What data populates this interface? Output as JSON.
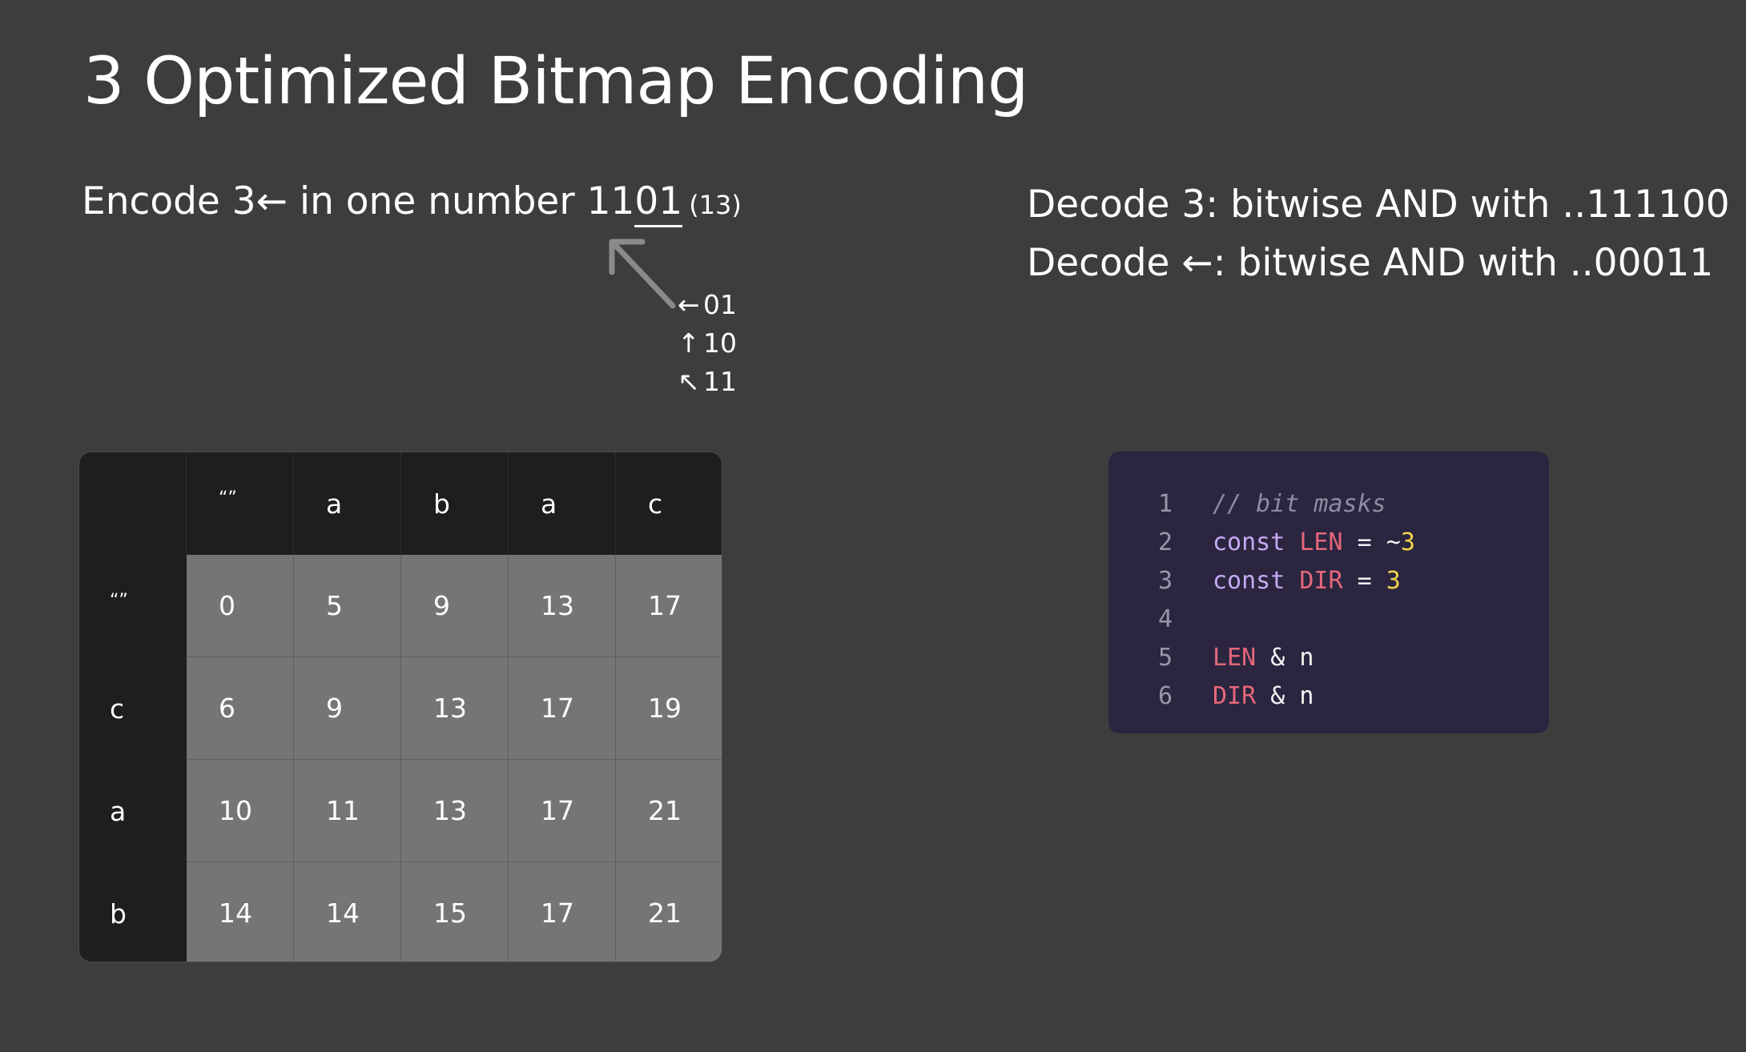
{
  "title": "3 Optimized Bitmap Encoding",
  "encode": {
    "prefix": "Encode 3",
    "arrow_glyph": "←",
    "mid": " in one number 11",
    "underlined": "01",
    "paren": "(13)"
  },
  "direction_legend": [
    {
      "icon": "left-arrow-icon",
      "glyph": "←",
      "bits": "01"
    },
    {
      "icon": "up-arrow-icon",
      "glyph": "↑",
      "bits": "10"
    },
    {
      "icon": "diagonal-up-left-arrow-icon",
      "glyph": "↖",
      "bits": "11"
    }
  ],
  "decode": [
    "Decode 3: bitwise AND with ..111100",
    "Decode ←: bitwise AND with ..00011"
  ],
  "table": {
    "col_headers": [
      "“”",
      "a",
      "b",
      "a",
      "c"
    ],
    "row_headers": [
      "“”",
      "c",
      "a",
      "b"
    ],
    "rows": [
      [
        "0",
        "5",
        "9",
        "13",
        "17"
      ],
      [
        "6",
        "9",
        "13",
        "17",
        "19"
      ],
      [
        "10",
        "11",
        "13",
        "17",
        "21"
      ],
      [
        "14",
        "14",
        "15",
        "17",
        "21"
      ]
    ]
  },
  "code": {
    "lines": [
      {
        "n": "1",
        "tokens": [
          {
            "t": "// bit masks",
            "k": "comment"
          }
        ]
      },
      {
        "n": "2",
        "tokens": [
          {
            "t": "const ",
            "k": "kw"
          },
          {
            "t": "LEN",
            "k": "var"
          },
          {
            "t": " = ~",
            "k": "op"
          },
          {
            "t": "3",
            "k": "num"
          }
        ]
      },
      {
        "n": "3",
        "tokens": [
          {
            "t": "const ",
            "k": "kw"
          },
          {
            "t": "DIR",
            "k": "var"
          },
          {
            "t": " = ",
            "k": "op"
          },
          {
            "t": "3",
            "k": "num"
          }
        ]
      },
      {
        "n": "4",
        "tokens": []
      },
      {
        "n": "5",
        "tokens": [
          {
            "t": "LEN",
            "k": "var"
          },
          {
            "t": " & n",
            "k": "op"
          }
        ]
      },
      {
        "n": "6",
        "tokens": [
          {
            "t": "DIR",
            "k": "var"
          },
          {
            "t": " & n",
            "k": "op"
          }
        ]
      }
    ]
  },
  "colors": {
    "background": "#3d3d3d",
    "table_header": "#1e1e1e",
    "table_cell": "#757575",
    "code_bg": "#2b2540",
    "code_keyword": "#c6a9f2",
    "code_variable": "#e5677a",
    "code_number": "#f2d34b",
    "code_comment": "#8f8aa0"
  }
}
